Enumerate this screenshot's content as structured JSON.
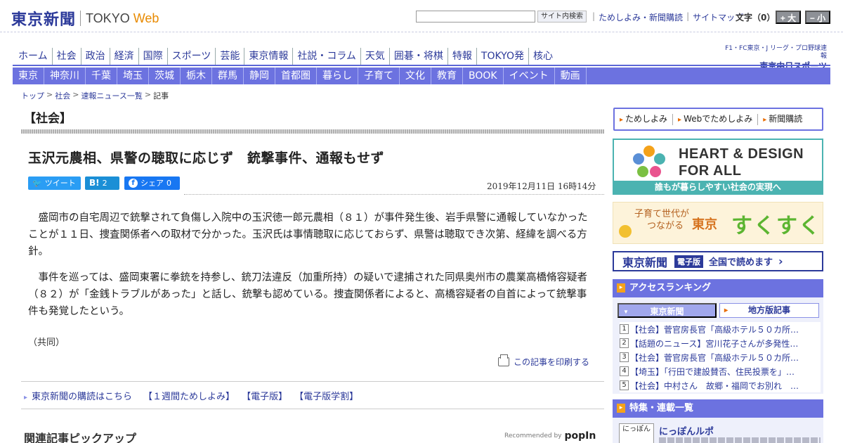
{
  "header": {
    "logo_jp": "東京新聞",
    "logo_en": "TOKYO",
    "logo_web": "Web",
    "search_button": "サイト内検索",
    "search_placeholder": "",
    "links": [
      "ためしよみ・新聞購読",
      "サイトマップ"
    ],
    "font_size_label": "文字（0）",
    "font_plus": "+ 大",
    "font_minus": "− 小"
  },
  "nav_main": [
    "ホーム",
    "社会",
    "政治",
    "経済",
    "国際",
    "スポーツ",
    "芸能",
    "東京情報",
    "社説・コラム",
    "天気",
    "囲碁・将棋",
    "特報",
    "TOKYO発",
    "核心"
  ],
  "sports_logo": {
    "line1": "F1・FC東京・J リーグ・プロ野球速報",
    "line2": "東京中日スポーツ"
  },
  "nav_region": [
    "東京",
    "神奈川",
    "千葉",
    "埼玉",
    "茨城",
    "栃木",
    "群馬",
    "静岡",
    "首都圏",
    "暮らし",
    "子育て",
    "文化",
    "教育",
    "BOOK",
    "イベント",
    "動画"
  ],
  "breadcrumb": [
    "トップ",
    "社会",
    "速報ニュース一覧",
    "記事"
  ],
  "section": "【社会】",
  "article": {
    "headline": "玉沢元農相、県警の聴取に応じず　銃撃事件、通報もせず",
    "date": "2019年12月11日 16時14分",
    "paragraphs": [
      "盛岡市の自宅周辺で銃撃されて負傷し入院中の玉沢徳一郎元農相（８１）が事件発生後、岩手県警に通報していなかったことが１１日、捜査関係者への取材で分かった。玉沢氏は事情聴取に応じておらず、県警は聴取でき次第、経緯を調べる方針。",
      "事件を巡っては、盛岡東署に拳銃を持参し、銃刀法違反（加重所持）の疑いで逮捕された同県奥州市の農業高橋脩容疑者（８２）が「金銭トラブルがあった」と話し、銃撃も認めている。捜査関係者によると、高橋容疑者の自首によって銃撃事件も発覚したという。"
    ],
    "credit": "（共同）",
    "print_label": "この記事を印刷する"
  },
  "share": {
    "tweet": "ツイート",
    "hatena_label": "B!",
    "hatena_count": "2",
    "facebook": "シェア",
    "facebook_count": "0"
  },
  "subscribe_links": [
    "東京新聞の購読はこちら",
    "【１週間ためしよみ】",
    "【電子版】",
    "【電子版学割】"
  ],
  "related": {
    "title": "関連記事ピックアップ",
    "recommended_by": "Recommended by",
    "popin": "popIn"
  },
  "sidebar": {
    "trial_links": [
      "ためしよみ",
      "Webでためしよみ",
      "新聞購読"
    ],
    "heart": {
      "title_line1": "HEART & DESIGN",
      "title_line2": "FOR ALL",
      "subtitle": "誰もが暮らしやすい社会の実現へ"
    },
    "sukusuku": {
      "small_line1": "子育て世代が",
      "small_line2": "つながる",
      "tokyo": "東京",
      "main": "すくすく"
    },
    "denshi": {
      "brand": "東京新聞",
      "badge": "電子版",
      "text": "全国で読めます",
      "arrow": "›"
    },
    "ranking": {
      "title": "アクセスランキング",
      "tab_active": "東京新聞",
      "tab_other": "地方版記事",
      "items": [
        {
          "num": "1",
          "text": "【社会】菅官房長官「高級ホテル５０カ所…"
        },
        {
          "num": "2",
          "text": "【話題のニュース】宮川花子さんが多発性…"
        },
        {
          "num": "3",
          "text": "【社会】菅官房長官「高級ホテル５０カ所…"
        },
        {
          "num": "4",
          "text": "【埼玉】「行田で建設賛否、住民投票を」…"
        },
        {
          "num": "5",
          "text": "【社会】中村さん　故郷・福岡でお別れ　…"
        }
      ]
    },
    "features": {
      "title": "特集・連載一覧",
      "item_thumb": "にっぽん",
      "item_title": "にっぽんルポ"
    }
  }
}
